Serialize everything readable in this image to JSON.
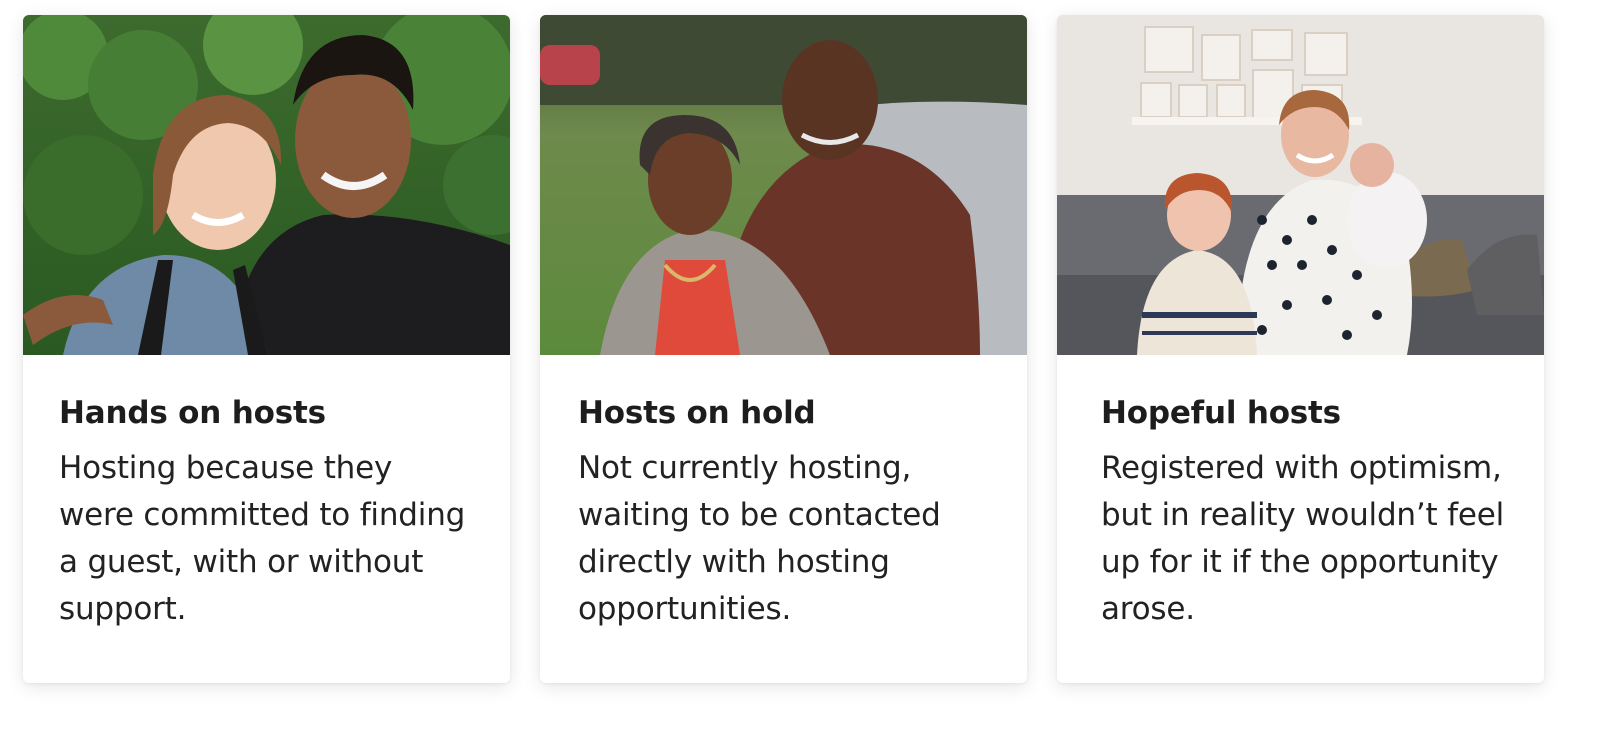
{
  "cards": [
    {
      "title": "Hands on hosts",
      "description": "Hosting because they were committed to finding a guest, with or without support.",
      "image": "couple-outdoors-photo"
    },
    {
      "title": "Hosts on hold",
      "description": "Not currently hosting, waiting to be contacted directly with hosting opportunities.",
      "image": "older-couple-photo"
    },
    {
      "title": "Hopeful hosts",
      "description": "Registered with optimism, but in reality wouldn’t feel up for it if the opportunity arose.",
      "image": "mother-children-sofa-photo"
    }
  ],
  "colors": {
    "card_background": "#ffffff",
    "title_text": "#1d1d1d",
    "body_text": "#222222"
  }
}
